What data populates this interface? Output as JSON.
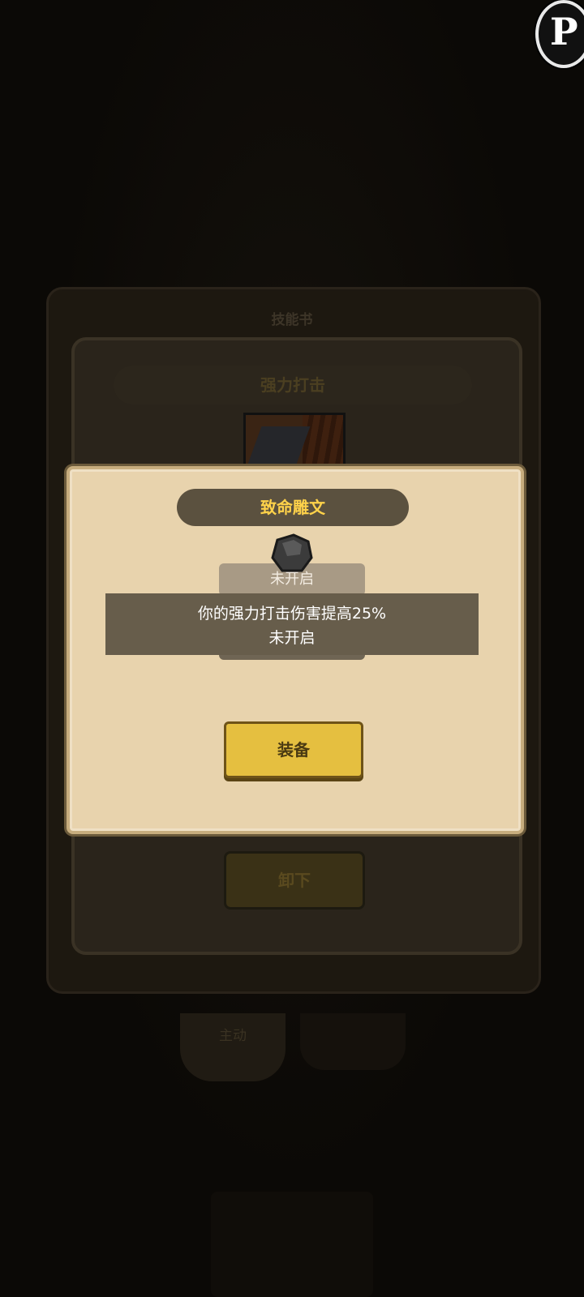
{
  "background": {
    "book_tab_label": "技能书",
    "skill_name": "强力打击",
    "unequip_label": "卸下",
    "tab_active_label": "主动"
  },
  "corner_badge": "P",
  "modal": {
    "title": "致命雕文",
    "status_top": "未开启",
    "description": "你的强力打击伤害提高25%",
    "status_bottom": "未开启",
    "equip_label": "装备"
  },
  "colors": {
    "title_text": "#ffd24a",
    "modal_bg": "#e8d3ad",
    "equip_button": "#e5bf40"
  }
}
